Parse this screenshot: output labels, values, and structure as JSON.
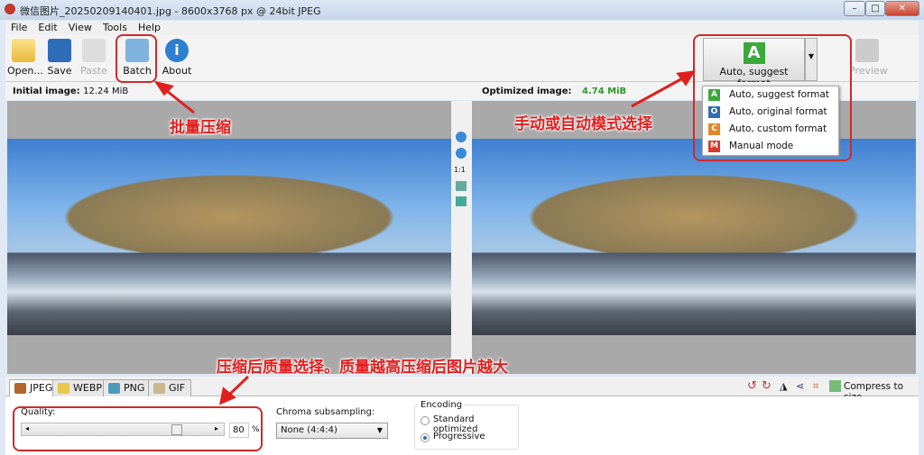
{
  "window": {
    "title": "微信图片_20250209140401.jpg - 8600x3768 px @ 24bit JPEG",
    "minimize": "–",
    "maximize": "□",
    "close": "✕"
  },
  "menu": [
    "File",
    "Edit",
    "View",
    "Tools",
    "Help"
  ],
  "toolbar": {
    "open": "Open...",
    "save": "Save",
    "paste": "Paste",
    "batch": "Batch",
    "about": "About",
    "mode_letter": "A",
    "mode_label": "Auto, suggest format",
    "preview": "Preview"
  },
  "mode_menu": [
    {
      "letter": "A",
      "label": "Auto, suggest format",
      "color": "#3aa83a"
    },
    {
      "letter": "O",
      "label": "Auto, original format",
      "color": "#2f6db0"
    },
    {
      "letter": "C",
      "label": "Auto, custom format",
      "color": "#e0852a"
    },
    {
      "letter": "M",
      "label": "Manual mode",
      "color": "#d93a2a"
    }
  ],
  "labels": {
    "initial_label": "Initial image:",
    "initial_size": "12.24 MiB",
    "optimized_label": "Optimized image:",
    "optimized_size": "4.74 MiB"
  },
  "zoom_tools": {
    "one_to_one": "1:1"
  },
  "tabs": [
    "JPEG",
    "WEBP",
    "PNG",
    "GIF"
  ],
  "right_tools": {
    "compress_to_size": "Compress to size"
  },
  "jpeg": {
    "quality_label": "Quality:",
    "quality_value": "80",
    "quality_unit": "%",
    "quality_percent": 80,
    "chroma_label": "Chroma subsampling:",
    "chroma_value": "None (4:4:4)",
    "encoding_label": "Encoding",
    "encoding_options": [
      "Standard optimized",
      "Progressive"
    ],
    "encoding_selected": "Progressive"
  },
  "annotations": {
    "batch": "批量压缩",
    "mode": "手动或自动模式选择",
    "quality": "压缩后质量选择。质量越高压缩后图片越大"
  },
  "colors": {
    "optimized_size": "#2a9a2a",
    "annotation": "#e02020"
  }
}
